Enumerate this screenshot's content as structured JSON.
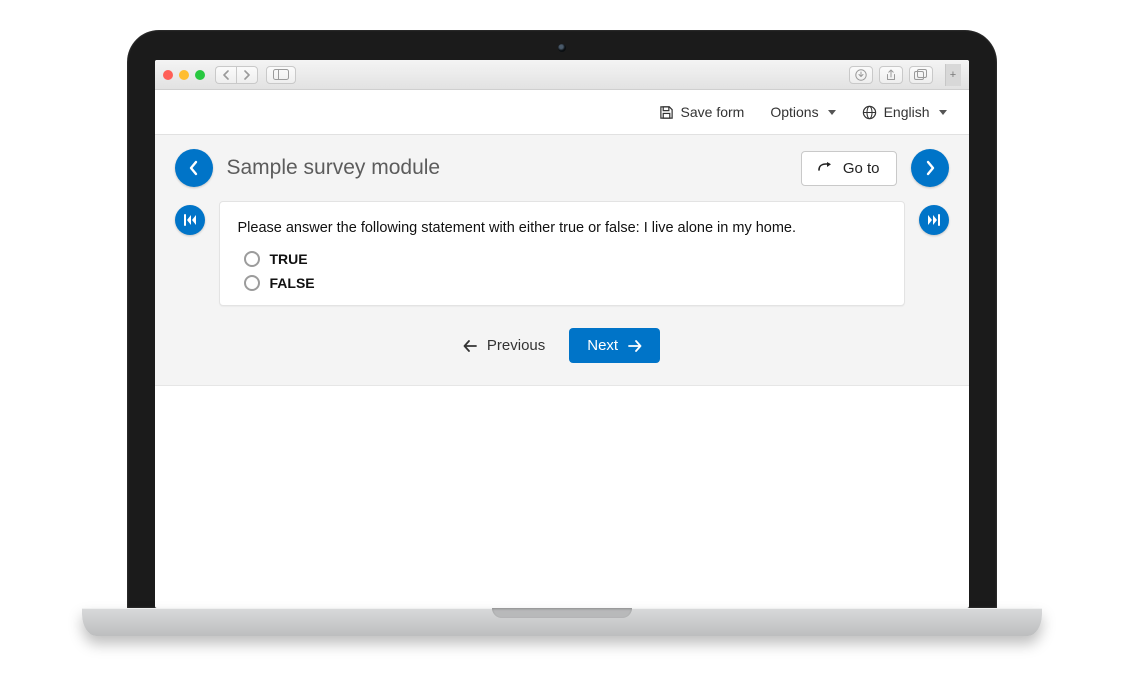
{
  "toolbar": {
    "save_label": "Save form",
    "options_label": "Options",
    "language_label": "English"
  },
  "survey": {
    "title": "Sample survey module",
    "goto_label": "Go to",
    "question": "Please answer the following statement with either true or false: I live alone in my home.",
    "options": [
      "TRUE",
      "FALSE"
    ]
  },
  "pager": {
    "previous_label": "Previous",
    "next_label": "Next"
  },
  "colors": {
    "primary": "#0074c8"
  }
}
